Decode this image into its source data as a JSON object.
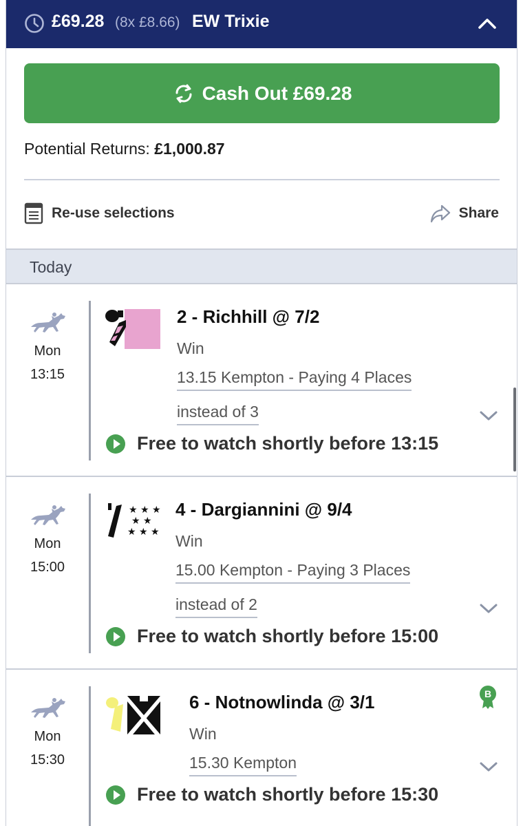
{
  "header": {
    "stake": "£69.28",
    "calc": "(8x £8.66)",
    "bet_type": "EW Trixie",
    "bg_color": "#1b2a6b"
  },
  "cashout": {
    "label": "Cash Out £69.28",
    "color": "#48a052"
  },
  "returns": {
    "label": "Potential Returns:",
    "value": "£1,000.87"
  },
  "actions": {
    "reuse": "Re-use selections",
    "share": "Share"
  },
  "day_band": "Today",
  "selections": [
    {
      "day": "Mon",
      "time": "13:15",
      "name": "2 - Richhill @ 7/2",
      "market": "Win",
      "race": "13.15 Kempton - Paying 4 Places",
      "race_cont": "instead of 3",
      "watch": "Free to watch shortly before 13:15"
    },
    {
      "day": "Mon",
      "time": "15:00",
      "name": "4 - Dargiannini @ 9/4",
      "market": "Win",
      "race": "15.00 Kempton - Paying 3 Places",
      "race_cont": "instead of 2",
      "watch": "Free to watch shortly before 15:00"
    },
    {
      "day": "Mon",
      "time": "15:30",
      "name": "6 - Notnowlinda @ 3/1",
      "market": "Win",
      "race": "15.30 Kempton",
      "badge": "B",
      "watch": "Free to watch shortly before 15:30"
    }
  ]
}
